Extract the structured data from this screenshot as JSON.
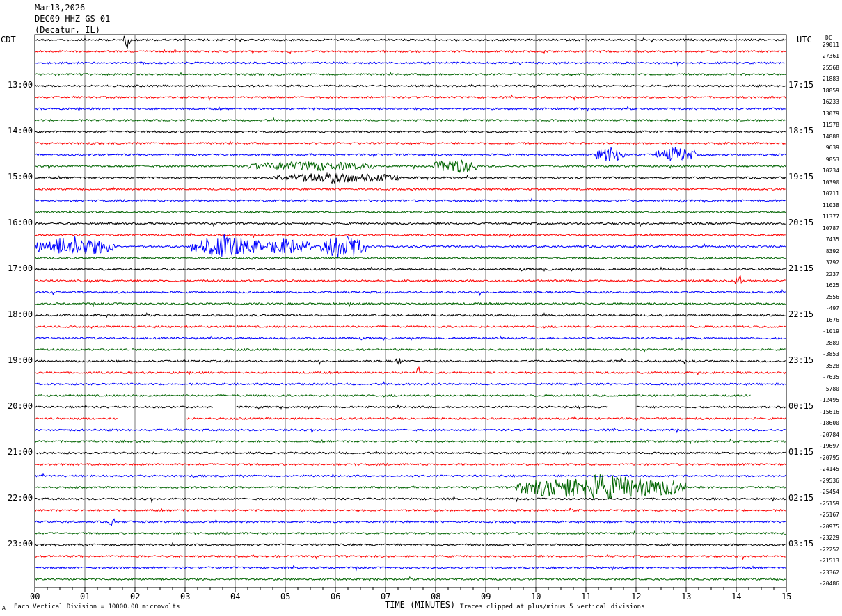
{
  "header": {
    "date": "Mar13,2026",
    "station": "DEC09 HHZ GS 01",
    "location": "(Decatur, IL)"
  },
  "left_tz": "CDT",
  "right_tz": "UTC",
  "dc_label": "DC",
  "footer": {
    "scale_note": "Each Vertical Division = 10000.00 microvolts",
    "clip_note": "Traces clipped at plus/minus 5 vertical divisions",
    "mark": "A"
  },
  "chart_data": {
    "type": "line",
    "xlabel": "TIME (MINUTES)",
    "xlim": [
      0,
      15
    ],
    "x_ticks": [
      "00",
      "01",
      "02",
      "03",
      "04",
      "05",
      "06",
      "07",
      "08",
      "09",
      "10",
      "11",
      "12",
      "13",
      "14",
      "15"
    ],
    "left_hour_labels": [
      "13:00",
      "14:00",
      "15:00",
      "16:00",
      "17:00",
      "18:00",
      "19:00",
      "20:00",
      "21:00",
      "22:00",
      "23:00"
    ],
    "right_hour_labels": [
      "17:15",
      "18:15",
      "19:15",
      "20:15",
      "21:15",
      "22:15",
      "23:15",
      "00:15",
      "01:15",
      "02:15",
      "03:15"
    ],
    "trace_colors": [
      "#000000",
      "#ff0000",
      "#0000ff",
      "#006400"
    ],
    "dc_offsets": [
      "29011",
      "27361",
      "25568",
      "21883",
      "18859",
      "16233",
      "13079",
      "11578",
      "14888",
      "9639",
      "9853",
      "10234",
      "10390",
      "10711",
      "11038",
      "11377",
      "10787",
      "7435",
      "8392",
      "3792",
      "2237",
      "1625",
      "2556",
      "-497",
      "1676",
      "-1019",
      "2889",
      "-3853",
      "3528",
      "-7635",
      "5780",
      "-12495",
      "-15616",
      "-18600",
      "-20784",
      "-19697",
      "-20795",
      "-24145",
      "-29536",
      "-25454",
      "-25159",
      "-25167",
      "-20975",
      "-23229",
      "-22252",
      "-21513",
      "-23362",
      "-20486"
    ],
    "gaps": [
      {
        "trace": 31,
        "from": 14.3,
        "to": 15.0
      },
      {
        "trace": 32,
        "from": 3.55,
        "to": 4.0
      },
      {
        "trace": 32,
        "from": 11.45,
        "to": 12.0
      },
      {
        "trace": 33,
        "from": 1.65,
        "to": 3.0
      }
    ],
    "events": [
      {
        "trace": 0,
        "at": 1.85,
        "amp": 2.5,
        "dur": 0.15
      },
      {
        "trace": 10,
        "at": 11.5,
        "amp": 2.5,
        "dur": 0.6
      },
      {
        "trace": 10,
        "at": 12.8,
        "amp": 2.5,
        "dur": 0.8
      },
      {
        "trace": 11,
        "at": 8.4,
        "amp": 2.5,
        "dur": 0.9
      },
      {
        "trace": 11,
        "at": 5.5,
        "amp": 1.5,
        "dur": 2.5
      },
      {
        "trace": 12,
        "at": 6.0,
        "amp": 1.7,
        "dur": 2.5
      },
      {
        "trace": 18,
        "at": 0.8,
        "amp": 3.5,
        "dur": 1.6
      },
      {
        "trace": 18,
        "at": 3.8,
        "amp": 4.0,
        "dur": 1.4
      },
      {
        "trace": 18,
        "at": 5.0,
        "amp": 2.8,
        "dur": 1.0
      },
      {
        "trace": 18,
        "at": 6.15,
        "amp": 4.5,
        "dur": 0.9
      },
      {
        "trace": 21,
        "at": 14.05,
        "amp": 2.0,
        "dur": 0.15
      },
      {
        "trace": 28,
        "at": 7.25,
        "amp": 2.0,
        "dur": 0.1
      },
      {
        "trace": 29,
        "at": 7.65,
        "amp": 3.0,
        "dur": 0.05
      },
      {
        "trace": 39,
        "at": 11.3,
        "amp": 4.5,
        "dur": 3.4
      },
      {
        "trace": 42,
        "at": 1.55,
        "amp": 1.2,
        "dur": 0.15
      }
    ]
  }
}
